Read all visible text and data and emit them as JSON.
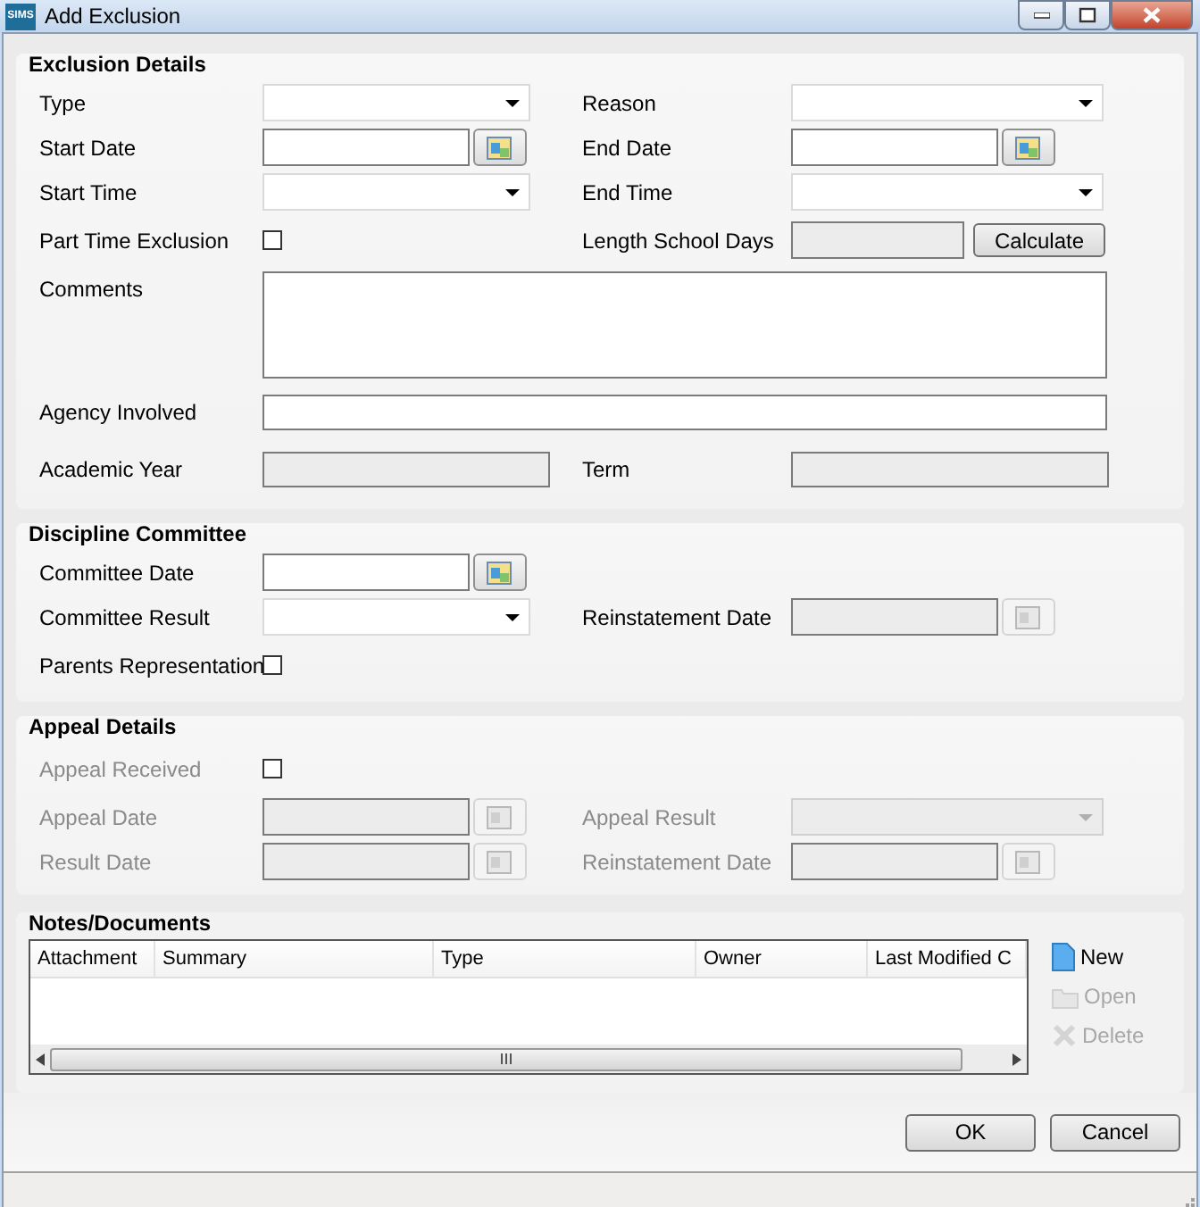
{
  "window": {
    "title": "Add Exclusion",
    "logo": "SIMS"
  },
  "sections": [
    {
      "title": "Exclusion Details",
      "rows": [
        [
          {
            "label": "Type",
            "kind": "dropdown",
            "disabled": false,
            "dimmed": false
          },
          {
            "label": "Reason",
            "kind": "dropdown",
            "disabled": false,
            "dimmed": false
          }
        ],
        [
          {
            "label": "Start Date",
            "kind": "date",
            "disabled": false,
            "dimmed": false
          },
          {
            "label": "End Date",
            "kind": "date",
            "disabled": false,
            "dimmed": false
          }
        ],
        [
          {
            "label": "Start Time",
            "kind": "dropdown",
            "disabled": false,
            "dimmed": false
          },
          {
            "label": "End Time",
            "kind": "dropdown",
            "disabled": false,
            "dimmed": false
          }
        ],
        [
          {
            "label": "Part Time Exclusion",
            "kind": "checkbox",
            "checked": false,
            "disabled": false,
            "dimmed": false
          },
          {
            "label": "Length School Days",
            "kind": "calc",
            "button": "Calculate",
            "disabled": true,
            "dimmed": false
          }
        ],
        [
          {
            "label": "Comments",
            "kind": "textarea",
            "disabled": false,
            "dimmed": false
          }
        ],
        [
          {
            "label": "Agency Involved",
            "kind": "text",
            "disabled": false,
            "dimmed": false
          }
        ],
        [
          {
            "label": "Academic Year",
            "kind": "readonly",
            "disabled": true,
            "dimmed": false
          },
          {
            "label": "Term",
            "kind": "readonly",
            "disabled": true,
            "dimmed": false
          }
        ]
      ]
    },
    {
      "title": "Discipline Committee",
      "rows": [
        [
          {
            "label": "Committee Date",
            "kind": "date",
            "disabled": false,
            "dimmed": false
          }
        ],
        [
          {
            "label": "Committee Result",
            "kind": "dropdown",
            "disabled": false,
            "dimmed": false
          },
          {
            "label": "Reinstatement Date",
            "kind": "date",
            "disabled": true,
            "dimmed": false
          }
        ],
        [
          {
            "label": "Parents Representation",
            "kind": "checkbox",
            "checked": false,
            "disabled": false,
            "dimmed": false
          }
        ]
      ]
    },
    {
      "title": "Appeal Details",
      "rows": [
        [
          {
            "label": "Appeal Received",
            "kind": "checkbox",
            "checked": false,
            "disabled": false,
            "dimmed": true
          }
        ],
        [
          {
            "label": "Appeal Date",
            "kind": "date",
            "disabled": true,
            "dimmed": true
          },
          {
            "label": "Appeal Result",
            "kind": "dropdown",
            "disabled": true,
            "dimmed": true
          }
        ],
        [
          {
            "label": "Result Date",
            "kind": "date",
            "disabled": true,
            "dimmed": true
          },
          {
            "label": "Reinstatement Date",
            "kind": "date",
            "disabled": true,
            "dimmed": true
          }
        ]
      ]
    }
  ],
  "notes": {
    "title": "Notes/Documents",
    "columns": [
      "Attachment",
      "Summary",
      "Type",
      "Owner",
      "Last Modified C"
    ],
    "actions": [
      {
        "label": "New",
        "kind": "new",
        "disabled": false
      },
      {
        "label": "Open",
        "kind": "open",
        "disabled": true
      },
      {
        "label": "Delete",
        "kind": "delete",
        "disabled": true
      }
    ]
  },
  "buttons": [
    "OK",
    "Cancel"
  ]
}
